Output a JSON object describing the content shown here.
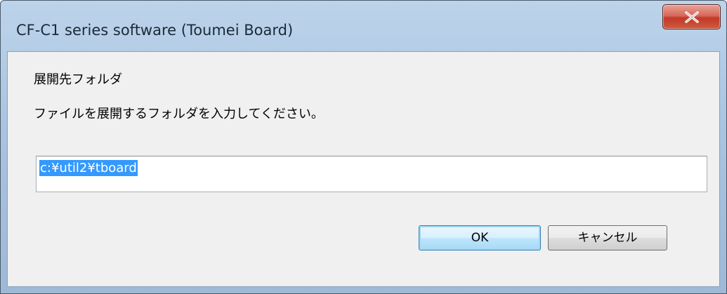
{
  "window": {
    "title": "CF-C1 series software (Toumei Board)",
    "close_icon": "close-icon"
  },
  "dialog": {
    "heading": "展開先フォルダ",
    "instruction": "ファイルを展開するフォルダを入力してください。",
    "path_value": "c:¥util2¥tboard",
    "ok_label": "OK",
    "cancel_label": "キャンセル"
  },
  "colors": {
    "selection": "#3399ff",
    "close_button": "#c23a28",
    "client_bg": "#f0f0f0"
  }
}
